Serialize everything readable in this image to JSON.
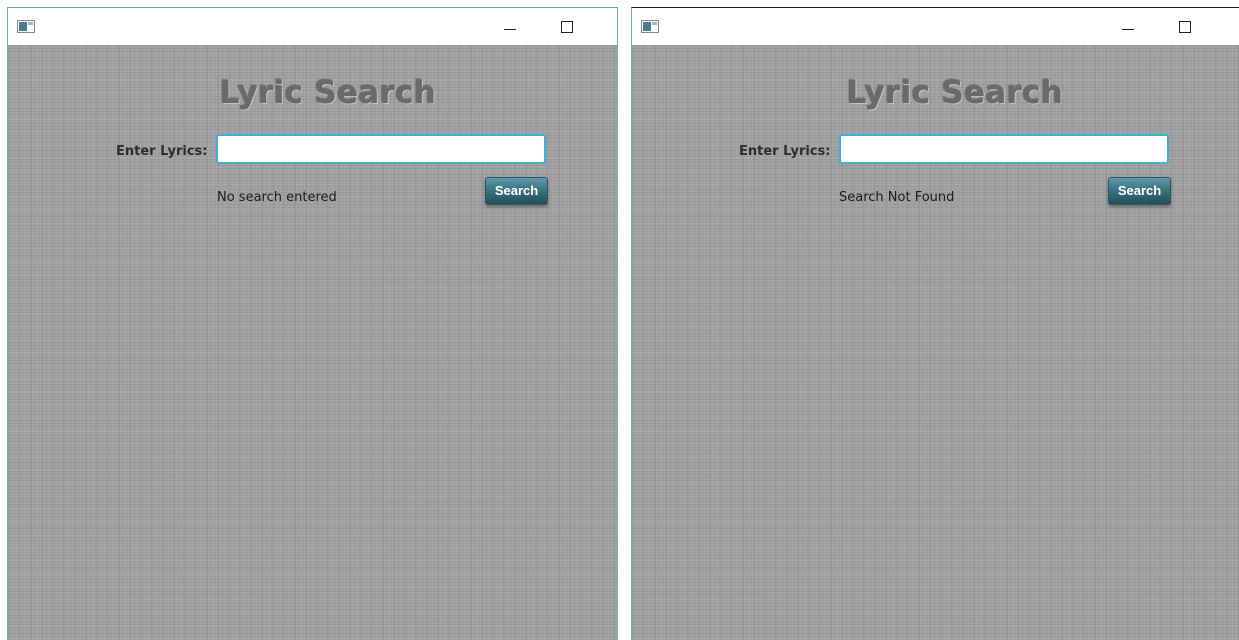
{
  "windows": [
    {
      "heading": "Lyric Search",
      "input_label": "Enter Lyrics:",
      "input_value": "",
      "status": "No search entered",
      "search_label": "Search",
      "app_icon": "window-app-icon",
      "minimize_icon": "minimize-icon",
      "maximize_icon": "maximize-icon"
    },
    {
      "heading": "Lyric Search",
      "input_label": "Enter Lyrics:",
      "input_value": "",
      "status": "Search Not Found",
      "search_label": "Search",
      "app_icon": "window-app-icon",
      "minimize_icon": "minimize-icon",
      "maximize_icon": "maximize-icon"
    }
  ],
  "colors": {
    "background": "#a1a1a1",
    "heading": "#6a6a6a",
    "input_focus_border": "#3fb0d4",
    "button": "#3b7482",
    "window_border": "#5fb3a0"
  }
}
